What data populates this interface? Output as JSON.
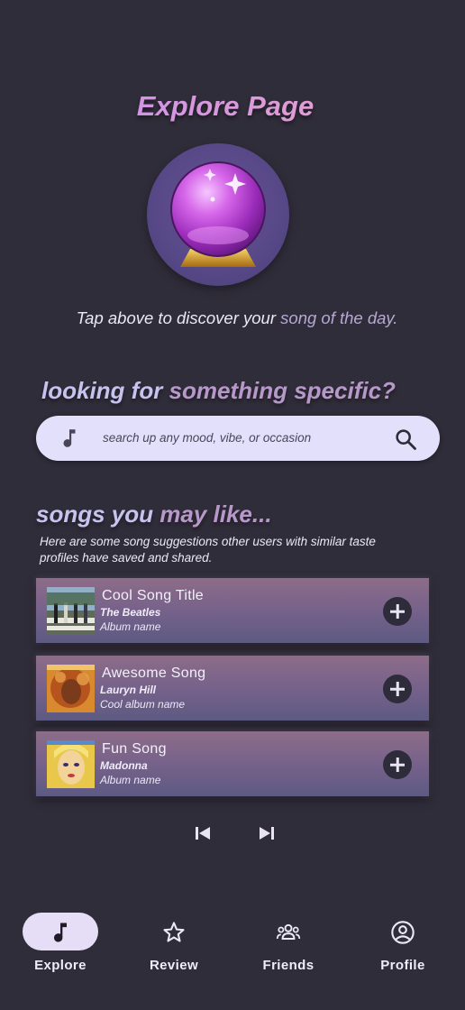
{
  "page": {
    "title": "Explore Page",
    "tagline_main": "Tap above to discover your ",
    "tagline_accent": "song of the day."
  },
  "search_section": {
    "heading_main": "looking for ",
    "heading_accent": "something specific?",
    "placeholder": "search up any mood, vibe, or occasion"
  },
  "suggestions": {
    "heading_main": "songs you ",
    "heading_accent": "may like...",
    "description": "Here are some song suggestions other users with similar taste profiles have saved and shared.",
    "songs": [
      {
        "title": "Cool Song Title",
        "artist": "The Beatles",
        "album": "Album name"
      },
      {
        "title": "Awesome Song",
        "artist": "Lauryn Hill",
        "album": "Cool album name"
      },
      {
        "title": "Fun Song",
        "artist": "Madonna",
        "album": "Album name"
      }
    ]
  },
  "nav": {
    "items": [
      {
        "label": "Explore",
        "icon": "music-note-icon",
        "active": true
      },
      {
        "label": "Review",
        "icon": "star-icon",
        "active": false
      },
      {
        "label": "Friends",
        "icon": "group-icon",
        "active": false
      },
      {
        "label": "Profile",
        "icon": "account-circle-icon",
        "active": false
      }
    ]
  },
  "colors": {
    "background": "#302d3a",
    "accent": "#b799c9",
    "search_bg": "#e2e0fb",
    "nav_active": "#e6def6"
  }
}
